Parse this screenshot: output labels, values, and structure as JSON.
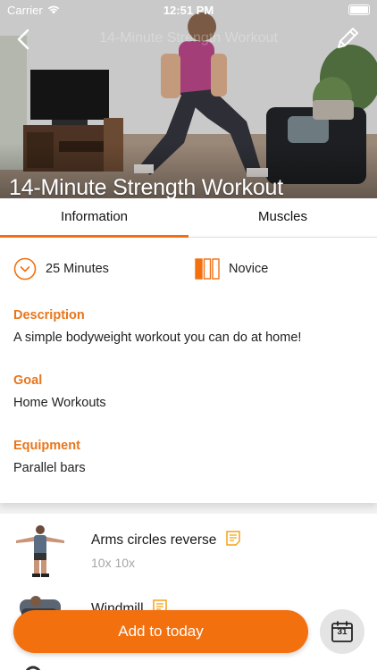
{
  "status_bar": {
    "carrier": "Carrier",
    "time": "12:51 PM"
  },
  "header": {
    "nav_title": "14-Minute Strength Workout",
    "title": "14-Minute Strength Workout",
    "back_icon": "chevron-left-icon",
    "edit_icon": "pencil-icon"
  },
  "tabs": [
    {
      "label": "Information",
      "active": true
    },
    {
      "label": "Muscles",
      "active": false
    }
  ],
  "info": {
    "duration": "25 Minutes",
    "level": "Novice",
    "level_bars_filled": 1,
    "level_bars_total": 3,
    "sections": [
      {
        "label": "Description",
        "value": "A simple bodyweight workout you can do at home!"
      },
      {
        "label": "Goal",
        "value": "Home Workouts"
      },
      {
        "label": "Equipment",
        "value": "Parallel bars"
      }
    ]
  },
  "exercises": [
    {
      "name": "Arms circles reverse",
      "sets": "10x 10x"
    },
    {
      "name": "Windmill",
      "sets": ""
    }
  ],
  "actions": {
    "add_label": "Add to today",
    "calendar_day": "31"
  },
  "colors": {
    "accent": "#f3700f",
    "label": "#e8761c"
  }
}
